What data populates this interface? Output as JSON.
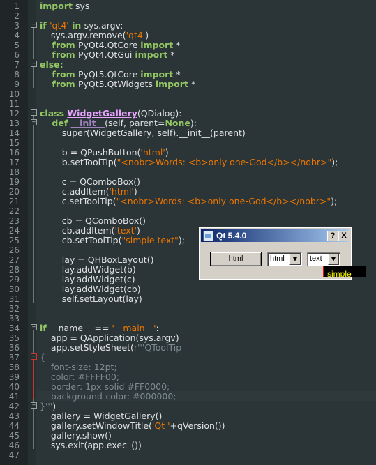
{
  "editor": {
    "lines": [
      {
        "n": "1",
        "segs": [
          {
            "t": "import",
            "c": "kw"
          },
          {
            "t": " sys",
            "c": ""
          }
        ]
      },
      {
        "n": "2",
        "segs": []
      },
      {
        "n": "3",
        "segs": [
          {
            "t": "if ",
            "c": "kw"
          },
          {
            "t": "'qt4'",
            "c": "str"
          },
          {
            "t": " in ",
            "c": "kw"
          },
          {
            "t": "sys.argv:",
            "c": ""
          }
        ]
      },
      {
        "n": "4",
        "segs": [
          {
            "t": "    sys.argv.remove(",
            "c": ""
          },
          {
            "t": "'qt4'",
            "c": "str"
          },
          {
            "t": ")",
            "c": ""
          }
        ]
      },
      {
        "n": "5",
        "segs": [
          {
            "t": "    from ",
            "c": "kw"
          },
          {
            "t": "PyQt4.QtCore ",
            "c": ""
          },
          {
            "t": "import",
            "c": "kw"
          },
          {
            "t": " *",
            "c": ""
          }
        ]
      },
      {
        "n": "6",
        "segs": [
          {
            "t": "    from ",
            "c": "kw"
          },
          {
            "t": "PyQt4.QtGui ",
            "c": ""
          },
          {
            "t": "import",
            "c": "kw"
          },
          {
            "t": " *",
            "c": ""
          }
        ]
      },
      {
        "n": "7",
        "segs": [
          {
            "t": "else:",
            "c": "kw"
          }
        ]
      },
      {
        "n": "8",
        "segs": [
          {
            "t": "    from ",
            "c": "kw"
          },
          {
            "t": "PyQt5.QtCore ",
            "c": ""
          },
          {
            "t": "import",
            "c": "kw"
          },
          {
            "t": " *",
            "c": ""
          }
        ]
      },
      {
        "n": "9",
        "segs": [
          {
            "t": "    from ",
            "c": "kw"
          },
          {
            "t": "PyQt5.QtWidgets ",
            "c": ""
          },
          {
            "t": "import",
            "c": "kw"
          },
          {
            "t": " *",
            "c": ""
          }
        ]
      },
      {
        "n": "10",
        "segs": []
      },
      {
        "n": "11",
        "segs": []
      },
      {
        "n": "12",
        "segs": [
          {
            "t": "class ",
            "c": "kw"
          },
          {
            "t": "WidgetGallery",
            "c": "cls"
          },
          {
            "t": "(QDialog):",
            "c": ""
          }
        ]
      },
      {
        "n": "13",
        "segs": [
          {
            "t": "    def ",
            "c": "kw"
          },
          {
            "t": "__init__",
            "c": "fn"
          },
          {
            "t": "(self, parent=",
            "c": ""
          },
          {
            "t": "None",
            "c": "kw"
          },
          {
            "t": "):",
            "c": ""
          }
        ]
      },
      {
        "n": "14",
        "segs": [
          {
            "t": "        super(WidgetGallery, self).__init__(parent)",
            "c": ""
          }
        ]
      },
      {
        "n": "15",
        "segs": []
      },
      {
        "n": "16",
        "segs": [
          {
            "t": "        b = QPushButton(",
            "c": ""
          },
          {
            "t": "'html'",
            "c": "str"
          },
          {
            "t": ")",
            "c": ""
          }
        ]
      },
      {
        "n": "17",
        "segs": [
          {
            "t": "        b.setToolTip(",
            "c": ""
          },
          {
            "t": "\"<nobr>Words: <b>only one-God</b></nobr>\"",
            "c": "str"
          },
          {
            "t": ");",
            "c": ""
          }
        ]
      },
      {
        "n": "18",
        "segs": []
      },
      {
        "n": "19",
        "segs": [
          {
            "t": "        c = QComboBox()",
            "c": ""
          }
        ]
      },
      {
        "n": "20",
        "segs": [
          {
            "t": "        c.addItem(",
            "c": ""
          },
          {
            "t": "'html'",
            "c": "str"
          },
          {
            "t": ")",
            "c": ""
          }
        ]
      },
      {
        "n": "21",
        "segs": [
          {
            "t": "        c.setToolTip(",
            "c": ""
          },
          {
            "t": "\"<nobr>Words: <b>only one-God</b></nobr>\"",
            "c": "str"
          },
          {
            "t": ");",
            "c": ""
          }
        ]
      },
      {
        "n": "22",
        "segs": []
      },
      {
        "n": "23",
        "segs": [
          {
            "t": "        cb = QComboBox()",
            "c": ""
          }
        ]
      },
      {
        "n": "24",
        "segs": [
          {
            "t": "        cb.addItem(",
            "c": ""
          },
          {
            "t": "'text'",
            "c": "str"
          },
          {
            "t": ")",
            "c": ""
          }
        ]
      },
      {
        "n": "25",
        "segs": [
          {
            "t": "        cb.setToolTip(",
            "c": ""
          },
          {
            "t": "\"simple text\"",
            "c": "str"
          },
          {
            "t": ");",
            "c": ""
          }
        ]
      },
      {
        "n": "26",
        "segs": []
      },
      {
        "n": "27",
        "segs": [
          {
            "t": "        lay = QHBoxLayout()",
            "c": ""
          }
        ]
      },
      {
        "n": "28",
        "segs": [
          {
            "t": "        lay.addWidget(b)",
            "c": ""
          }
        ]
      },
      {
        "n": "29",
        "segs": [
          {
            "t": "        lay.addWidget(c)",
            "c": ""
          }
        ]
      },
      {
        "n": "30",
        "segs": [
          {
            "t": "        lay.addWidget(cb)",
            "c": ""
          }
        ]
      },
      {
        "n": "31",
        "segs": [
          {
            "t": "        self.setLayout(lay)",
            "c": ""
          }
        ]
      },
      {
        "n": "32",
        "segs": []
      },
      {
        "n": "33",
        "segs": []
      },
      {
        "n": "34",
        "segs": [
          {
            "t": "if ",
            "c": "kw"
          },
          {
            "t": "__name__ == ",
            "c": ""
          },
          {
            "t": "'__main__'",
            "c": "str"
          },
          {
            "t": ":",
            "c": ""
          }
        ]
      },
      {
        "n": "35",
        "segs": [
          {
            "t": "    app = QApplication(sys.argv)",
            "c": ""
          }
        ]
      },
      {
        "n": "36",
        "segs": [
          {
            "t": "    app.setStyleSheet(",
            "c": ""
          },
          {
            "t": "r'''QToolTip",
            "c": "cmt"
          }
        ]
      },
      {
        "n": "37",
        "segs": [
          {
            "t": "{",
            "c": "cmt"
          }
        ]
      },
      {
        "n": "38",
        "segs": [
          {
            "t": "    font-size: 12pt;",
            "c": "cmt"
          }
        ]
      },
      {
        "n": "39",
        "segs": [
          {
            "t": "    color: #FFFF00;",
            "c": "cmt"
          }
        ]
      },
      {
        "n": "40",
        "segs": [
          {
            "t": "    border: 1px solid #FF0000;",
            "c": "cmt"
          }
        ]
      },
      {
        "n": "41",
        "segs": [
          {
            "t": "    background-color: #000000;",
            "c": "cmt"
          }
        ]
      },
      {
        "n": "42",
        "segs": [
          {
            "t": "}'''",
            "c": "cmt"
          },
          {
            "t": ")",
            "c": ""
          }
        ]
      },
      {
        "n": "43",
        "segs": [
          {
            "t": "    gallery = WidgetGallery()",
            "c": ""
          }
        ]
      },
      {
        "n": "44",
        "segs": [
          {
            "t": "    gallery.setWindowTitle(",
            "c": ""
          },
          {
            "t": "'Qt '",
            "c": "str"
          },
          {
            "t": "+qVersion())",
            "c": ""
          }
        ]
      },
      {
        "n": "45",
        "segs": [
          {
            "t": "    gallery.show()",
            "c": ""
          }
        ]
      },
      {
        "n": "46",
        "segs": [
          {
            "t": "    sys.exit(app.exec_())",
            "c": ""
          }
        ]
      },
      {
        "n": "47",
        "segs": []
      }
    ],
    "colors": {
      "keyword": "#93c763",
      "string": "#ec7600",
      "class": "#e8a3ff",
      "comment": "#7d8c93",
      "text": "#e0e2e4",
      "background": "#2b3436"
    }
  },
  "qt_window": {
    "title": "Qt 5.4.0",
    "help_button": "?",
    "close_button": "X",
    "push_button_label": "html",
    "combo1_value": "html",
    "combo2_value": "text",
    "tooltip_text": "simple"
  }
}
